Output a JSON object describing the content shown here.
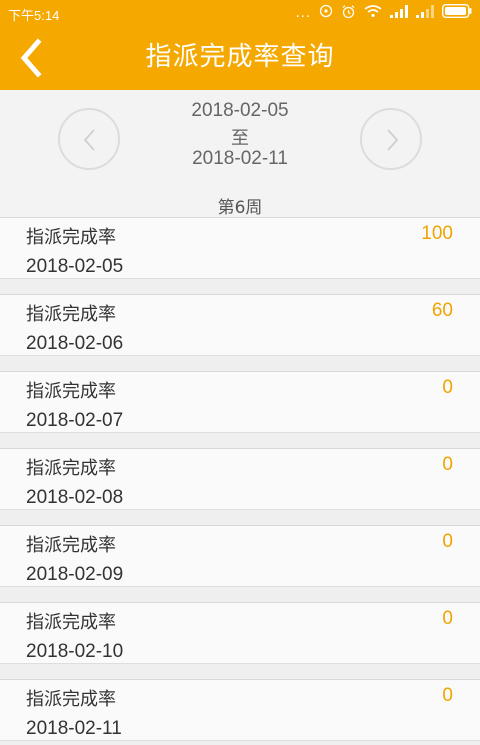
{
  "status_bar": {
    "time": "下午5:14",
    "icons": [
      "more-dots-icon",
      "alarm-icon",
      "alarm-clock-icon",
      "wifi-icon",
      "signal-icon",
      "signal-icon",
      "battery-icon"
    ],
    "more_dots": "...",
    "accent_color": "#f5a800"
  },
  "header": {
    "title": "指派完成率查询",
    "back_icon": "chevron-left-icon"
  },
  "week": {
    "start": "2018-02-05",
    "separator": "至",
    "end": "2018-02-11",
    "label": "第6周",
    "prev_icon": "chevron-left-icon",
    "next_icon": "chevron-right-icon"
  },
  "rows": [
    {
      "label": "指派完成率",
      "value": "100",
      "date": "2018-02-05"
    },
    {
      "label": "指派完成率",
      "value": "60",
      "date": "2018-02-06"
    },
    {
      "label": "指派完成率",
      "value": "0",
      "date": "2018-02-07"
    },
    {
      "label": "指派完成率",
      "value": "0",
      "date": "2018-02-08"
    },
    {
      "label": "指派完成率",
      "value": "0",
      "date": "2018-02-09"
    },
    {
      "label": "指派完成率",
      "value": "0",
      "date": "2018-02-10"
    },
    {
      "label": "指派完成率",
      "value": "0",
      "date": "2018-02-11"
    }
  ]
}
